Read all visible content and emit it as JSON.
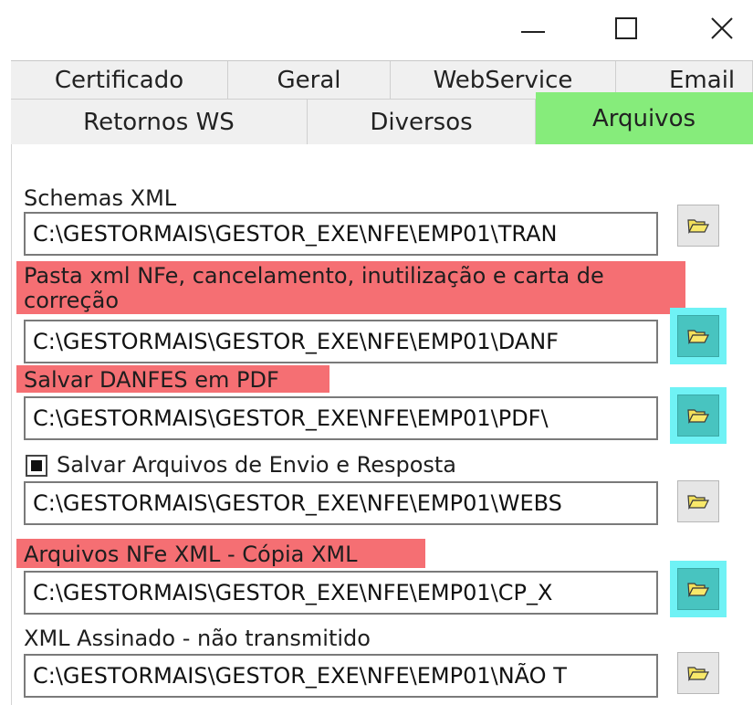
{
  "window": {
    "minimize_icon": "minimize-icon",
    "maximize_icon": "maximize-icon",
    "close_icon": "close-icon"
  },
  "tabs": {
    "row1": [
      "Certificado",
      "Geral",
      "WebService",
      "Email"
    ],
    "row2": [
      "Retornos WS",
      "Diversos",
      "Arquivos"
    ],
    "active": "Arquivos",
    "active_color": "#86ec7b"
  },
  "highlight_colors": {
    "label": "#f56f73",
    "button": "#6ff2f5"
  },
  "sections": [
    {
      "label": "Schemas XML",
      "path": "C:\\GESTORMAIS\\GESTOR_EXE\\NFE\\EMP01\\TRAN"
    },
    {
      "label": "Pasta xml NFe, cancelamento, inutilização e carta de",
      "label_line2": "correção",
      "path": "C:\\GESTORMAIS\\GESTOR_EXE\\NFE\\EMP01\\DANF"
    },
    {
      "label": "Salvar DANFES em PDF",
      "path": "C:\\GESTORMAIS\\GESTOR_EXE\\NFE\\EMP01\\PDF\\"
    },
    {
      "label": "Salvar Arquivos de Envio e Resposta",
      "checked": true,
      "path": "C:\\GESTORMAIS\\GESTOR_EXE\\NFE\\EMP01\\WEBS"
    },
    {
      "label": "Arquivos NFe XML - Cópia XML",
      "path": "C:\\GESTORMAIS\\GESTOR_EXE\\NFE\\EMP01\\CP_X"
    },
    {
      "label": "XML Assinado - não transmitido",
      "path": "C:\\GESTORMAIS\\GESTOR_EXE\\NFE\\EMP01\\NÃO T"
    }
  ],
  "folder_icon": "folder-open-icon"
}
